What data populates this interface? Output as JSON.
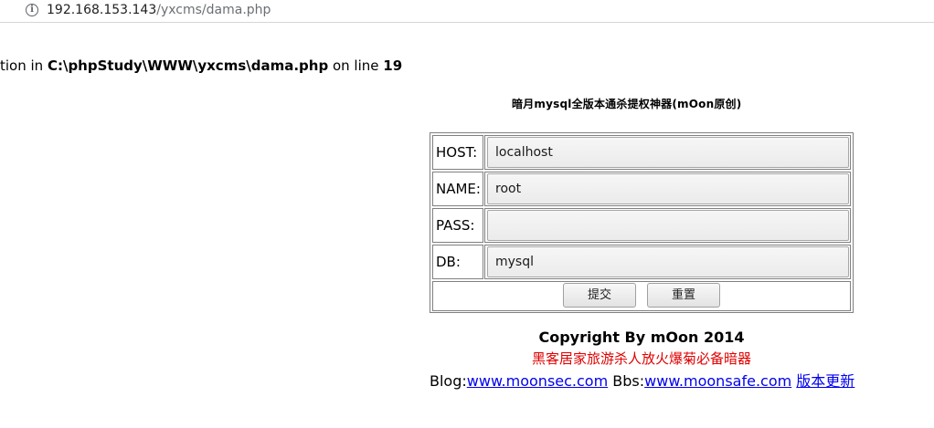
{
  "browser": {
    "url_host": "192.168.153.143",
    "url_path": "/yxcms/dama.php",
    "info_icon": "info-icon"
  },
  "warning": {
    "prefix": "tion in ",
    "file": "C:\\phpStudy\\WWW\\yxcms\\dama.php",
    "middle": " on line ",
    "line": "19"
  },
  "tool": {
    "title": "暗月mysql全版本通杀提权神器(mOon原创)"
  },
  "form": {
    "host_label": "HOST:",
    "host_value": "localhost",
    "name_label": "NAME:",
    "name_value": "root",
    "pass_label": "PASS:",
    "pass_value": "",
    "db_label": "DB:",
    "db_value": "mysql",
    "submit_label": "提交",
    "reset_label": "重置"
  },
  "footer": {
    "copyright": "Copyright By mOon 2014",
    "slogan": "黑客居家旅游杀人放火爆菊必备暗器",
    "blog_label": "Blog:",
    "blog_link": "www.moonsec.com",
    "bbs_label": " Bbs:",
    "bbs_link": "www.moonsafe.com",
    "update_link": "版本更新",
    "slogan_color": "#e00000",
    "link_color": "#0000ee"
  }
}
